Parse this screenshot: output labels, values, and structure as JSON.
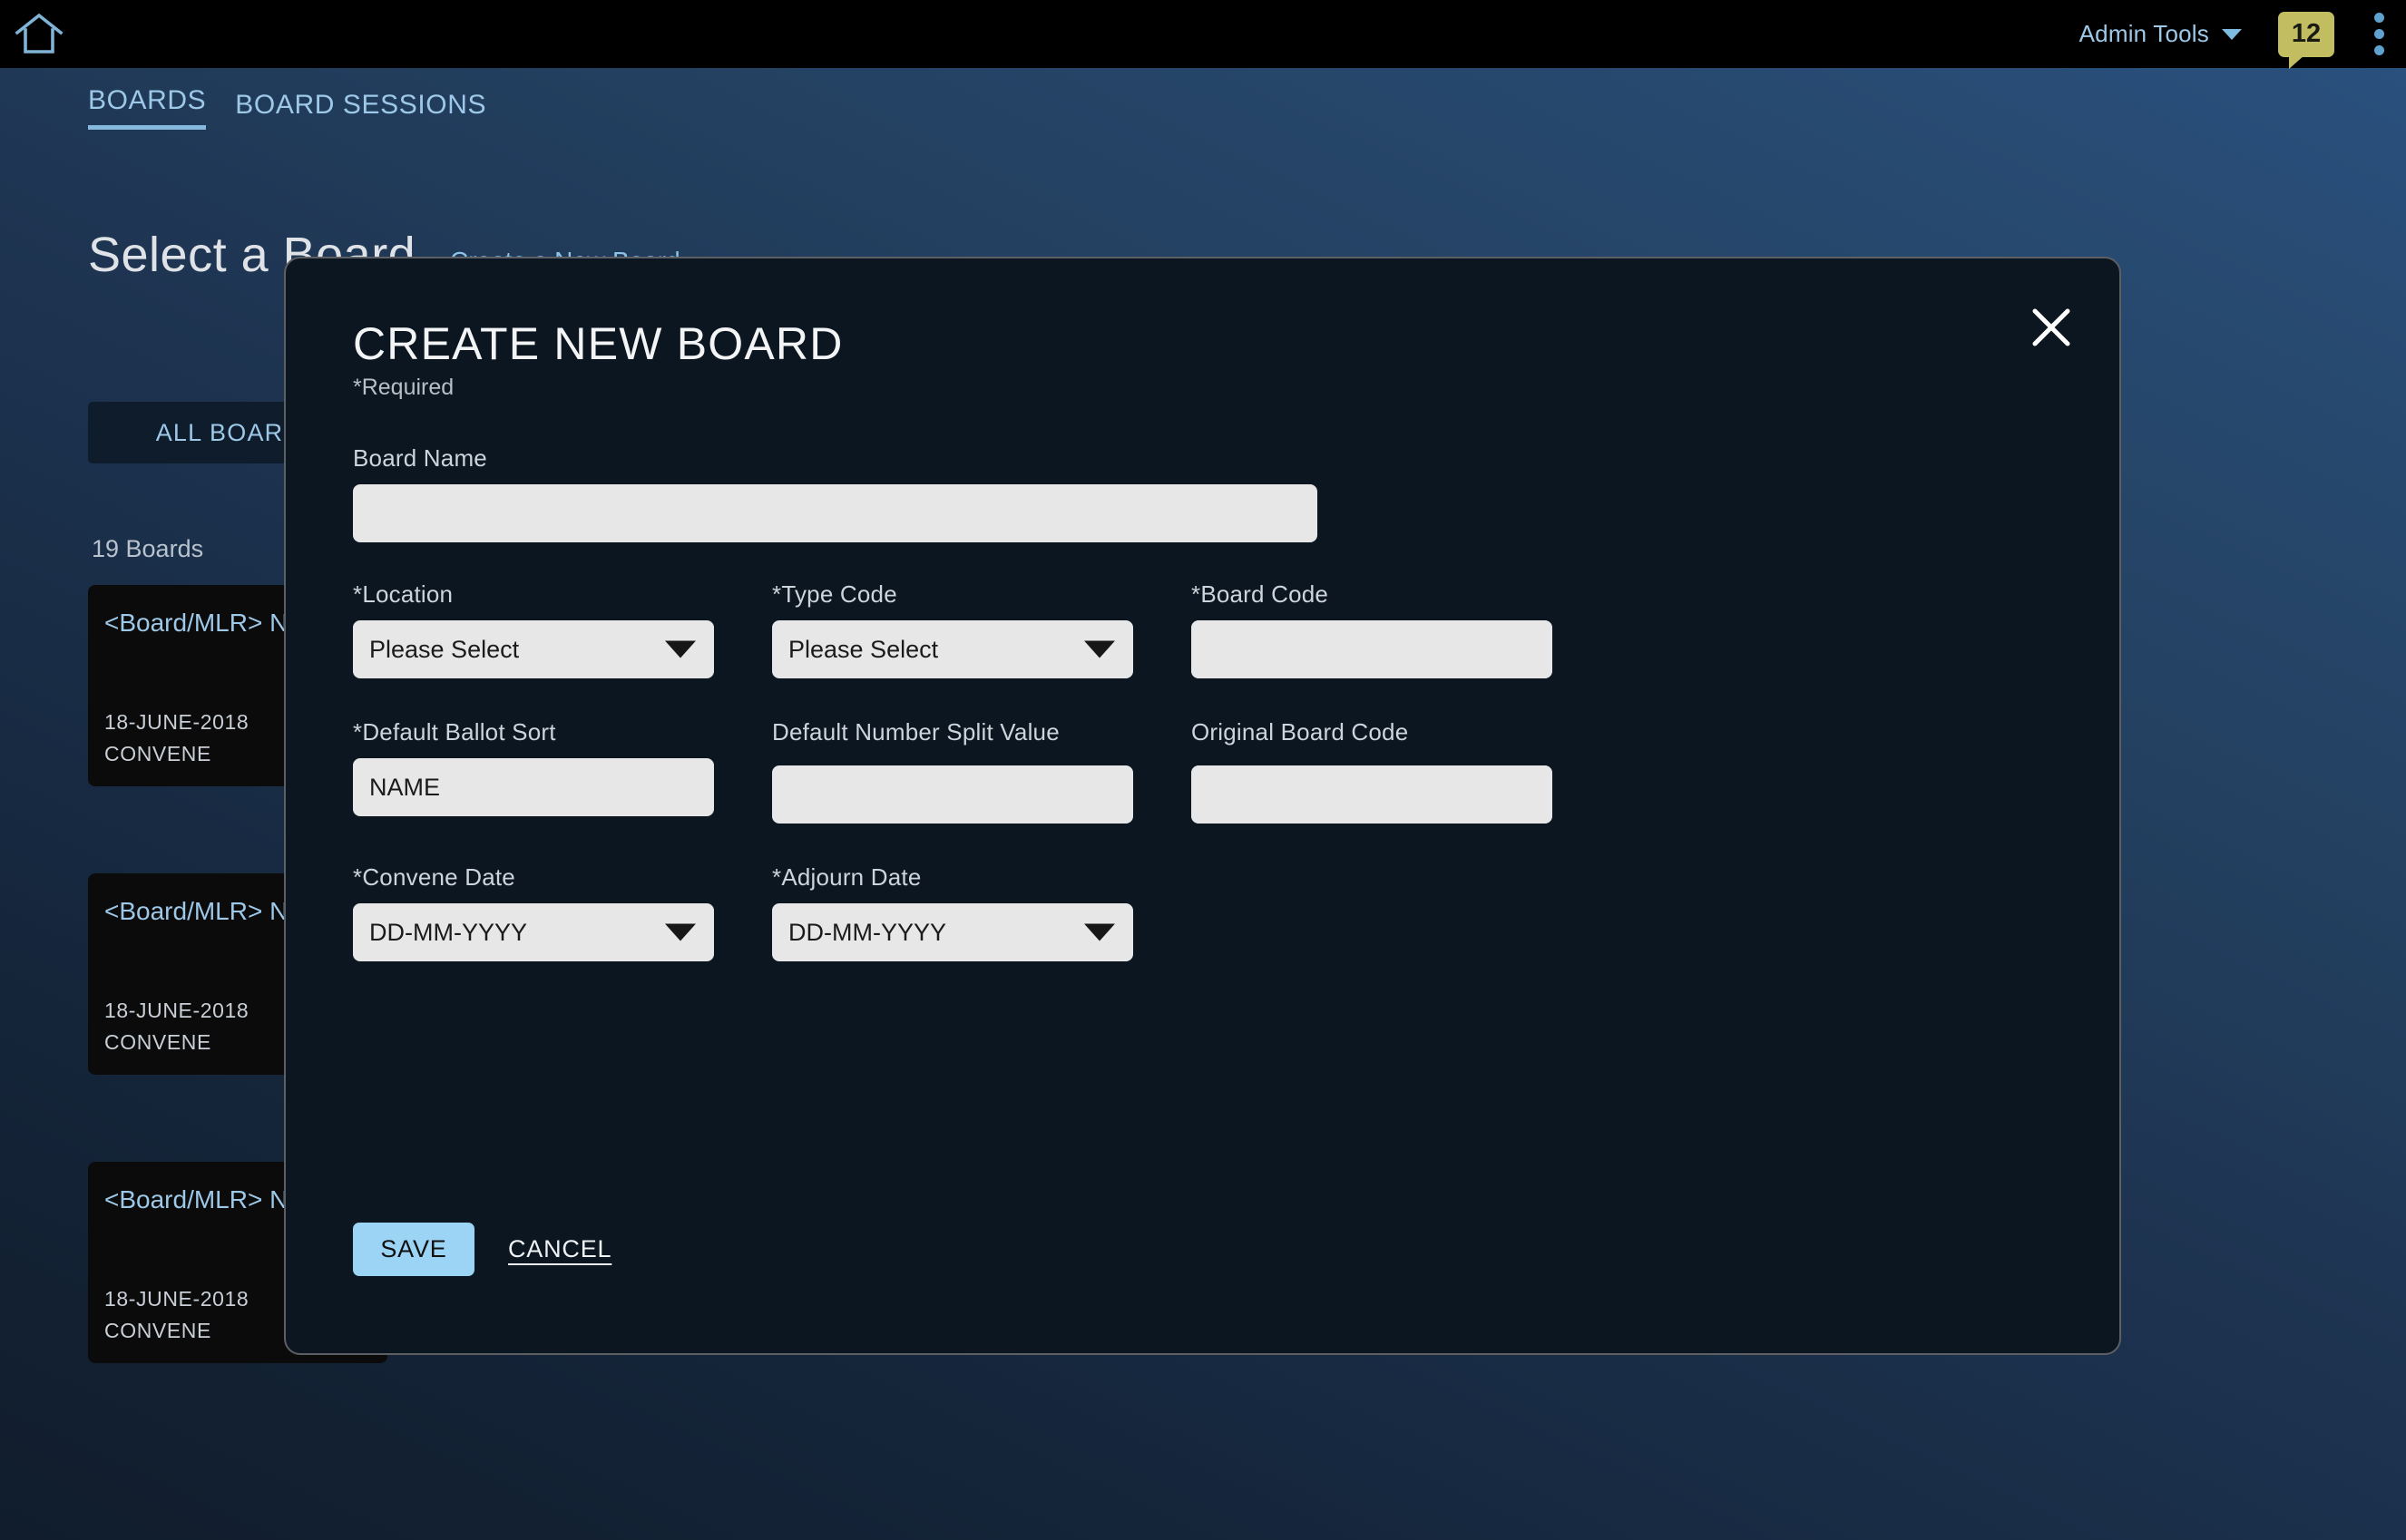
{
  "topbar": {
    "home_icon": "home-icon",
    "admin_tools_label": "Admin Tools",
    "caret_icon": "chevron-down-icon",
    "notification_count": "12",
    "kebab_icon": "more-vertical-icon"
  },
  "nav": {
    "tabs": [
      {
        "label": "BOARDS",
        "active": true
      },
      {
        "label": "BOARD SESSIONS",
        "active": false
      }
    ]
  },
  "page": {
    "title": "Select a Board",
    "create_link": "Create a New Board",
    "filter_button": "ALL BOARDS",
    "boards_count": "19 Boards",
    "cards": [
      {
        "name": "<Board/MLR> Name",
        "date": "18-JUNE-2018",
        "status": "CONVENE"
      },
      {
        "name": "<Board/MLR> Name",
        "date": "18-JUNE-2018",
        "status": "CONVENE"
      },
      {
        "name": "<Board/MLR> Name",
        "date": "18-JUNE-2018",
        "status": "CONVENE"
      }
    ]
  },
  "modal": {
    "title": "CREATE NEW BOARD",
    "required_note": "*Required",
    "close_icon": "close-icon",
    "fields": {
      "board_name": {
        "label": "Board Name",
        "value": "",
        "placeholder": ""
      },
      "location": {
        "label": "*Location",
        "value": "Please Select"
      },
      "type_code": {
        "label": "*Type Code",
        "value": "Please Select"
      },
      "board_code": {
        "label": "*Board Code",
        "value": "",
        "placeholder": ""
      },
      "default_ballot_sort": {
        "label": "*Default Ballot Sort",
        "value": "NAME"
      },
      "default_number_split_value": {
        "label": "Default Number Split Value",
        "value": "",
        "placeholder": ""
      },
      "original_board_code": {
        "label": "Original Board Code",
        "value": "",
        "placeholder": ""
      },
      "convene_date": {
        "label": "*Convene Date",
        "value": "DD-MM-YYYY"
      },
      "adjourn_date": {
        "label": "*Adjourn Date",
        "value": "DD-MM-YYYY"
      }
    },
    "actions": {
      "save_label": "SAVE",
      "cancel_label": "CANCEL"
    }
  },
  "colors": {
    "accent_blue": "#9ec8e8",
    "save_button": "#9bd4f5",
    "badge": "#c2bd61",
    "modal_bg": "#0c1620",
    "input_bg": "#e7e7e7"
  }
}
